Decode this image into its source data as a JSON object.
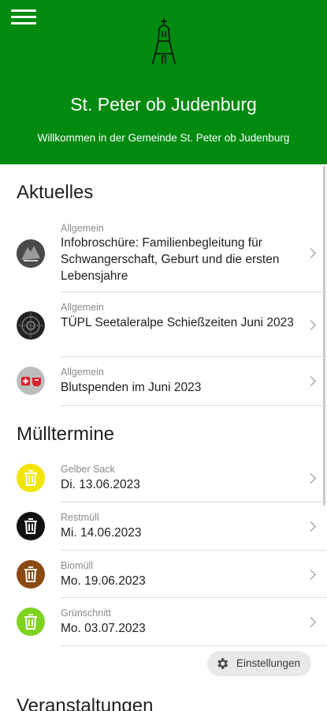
{
  "header": {
    "title": "St. Peter ob Judenburg",
    "subtitle": "Willkommen in der Gemeinde St. Peter ob Judenburg",
    "bg_color": "#008a0f",
    "menu_icon": "hamburger-menu-icon",
    "logo_icon": "church-tower-logo"
  },
  "news": {
    "title": "Aktuelles",
    "items": [
      {
        "category": "Allgemein",
        "text": "Infobroschüre: Familienbegleitung für Schwangerschaft, Geburt und die ersten Lebensjahre",
        "icon": "hand-photo-thumbnail"
      },
      {
        "category": "Allgemein",
        "text": "TÜPL Seetaleralpe Schießzeiten Juni 2023",
        "icon": "target-thumbnail"
      },
      {
        "category": "Allgemein",
        "text": "Blutspenden im Juni 2023",
        "icon": "blood-donation-thumbnail"
      }
    ]
  },
  "waste": {
    "title": "Mülltermine",
    "items": [
      {
        "type": "Gelber Sack",
        "date": "Di. 13.06.2023",
        "color": "#f2e600",
        "icon": "trash-can-icon"
      },
      {
        "type": "Restmüll",
        "date": "Mi. 14.06.2023",
        "color": "#111111",
        "icon": "trash-can-icon"
      },
      {
        "type": "Biomüll",
        "date": "Mo. 19.06.2023",
        "color": "#8b4a12",
        "icon": "trash-can-icon"
      },
      {
        "type": "Grünschnitt",
        "date": "Mo. 03.07.2023",
        "color": "#7ed321",
        "icon": "trash-can-icon"
      }
    ]
  },
  "settings": {
    "label": "Einstellungen",
    "icon": "gear-icon"
  },
  "events": {
    "title": "Veranstaltungen"
  }
}
